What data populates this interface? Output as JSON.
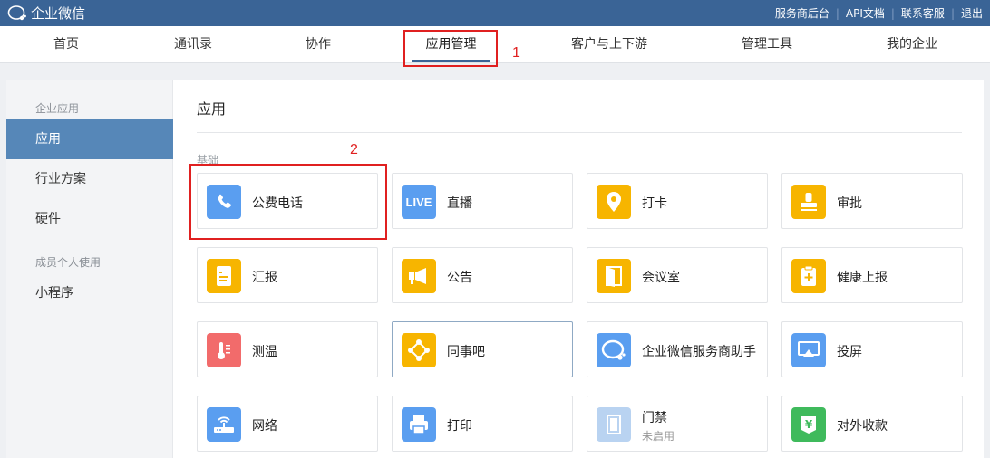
{
  "app": {
    "logo_text": "企业微信"
  },
  "toplinks": [
    "服务商后台",
    "API文档",
    "联系客服",
    "退出"
  ],
  "nav": {
    "items": [
      "首页",
      "通讯录",
      "协作",
      "应用管理",
      "客户与上下游",
      "管理工具",
      "我的企业"
    ],
    "active": "应用管理"
  },
  "annotations": {
    "one": "1",
    "two": "2"
  },
  "sidebar": {
    "group1": "企业应用",
    "items1": [
      "应用",
      "行业方案",
      "硬件"
    ],
    "group2": "成员个人使用",
    "items2": [
      "小程序"
    ]
  },
  "content": {
    "title": "应用",
    "section": "基础",
    "apps": [
      {
        "name": "公费电话",
        "icon": "phone-icon",
        "color": "#5a9ef0"
      },
      {
        "name": "直播",
        "icon": "live-icon",
        "color": "#5a9ef0"
      },
      {
        "name": "打卡",
        "icon": "location-pin-icon",
        "color": "#f7b500"
      },
      {
        "name": "审批",
        "icon": "stamp-icon",
        "color": "#f7b500"
      },
      {
        "name": "汇报",
        "icon": "report-icon",
        "color": "#f7b500"
      },
      {
        "name": "公告",
        "icon": "megaphone-icon",
        "color": "#f7b500"
      },
      {
        "name": "会议室",
        "icon": "door-icon",
        "color": "#f7b500"
      },
      {
        "name": "健康上报",
        "icon": "health-clipboard-icon",
        "color": "#f7b500"
      },
      {
        "name": "测温",
        "icon": "thermometer-icon",
        "color": "#f26b6b"
      },
      {
        "name": "同事吧",
        "icon": "network-icon",
        "color": "#f7b500"
      },
      {
        "name": "企业微信服务商助手",
        "icon": "chat-bubble-icon",
        "color": "#5a9ef0"
      },
      {
        "name": "投屏",
        "icon": "screencast-icon",
        "color": "#5a9ef0"
      },
      {
        "name": "网络",
        "icon": "router-icon",
        "color": "#5a9ef0"
      },
      {
        "name": "打印",
        "icon": "printer-icon",
        "color": "#5a9ef0"
      },
      {
        "name": "门禁",
        "sub": "未启用",
        "icon": "access-door-icon",
        "color": "#b9d3f1"
      },
      {
        "name": "对外收款",
        "icon": "yuan-payment-icon",
        "color": "#3fba5c"
      }
    ]
  }
}
